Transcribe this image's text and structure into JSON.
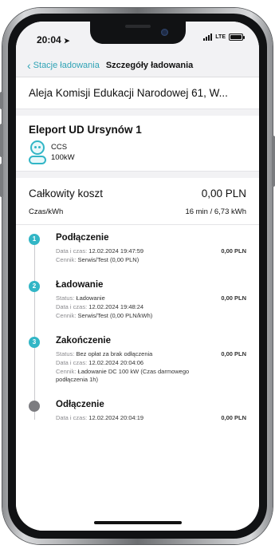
{
  "status_bar": {
    "time": "20:04",
    "network": "LTE",
    "icons": [
      "location-arrow-icon",
      "signal-icon",
      "battery-icon"
    ]
  },
  "nav": {
    "back_label": "Stacje ładowania",
    "title": "Szczegóły ładowania"
  },
  "address": "Aleja Komisji Edukacji Narodowej 61, W...",
  "station": {
    "name": "Eleport UD Ursynów 1",
    "connector_type": "CCS",
    "power": "100kW"
  },
  "cost": {
    "label": "Całkowity koszt",
    "value": "0,00 PLN",
    "time_energy_label": "Czas/kWh",
    "time_energy_value": "16 min / 6,73 kWh"
  },
  "timeline": [
    {
      "step": "1",
      "title": "Podłączenie",
      "details": [
        {
          "key": "Data i czas:",
          "value": "12.02.2024 19:47:59",
          "amount": "0,00 PLN"
        },
        {
          "key": "Cennik:",
          "value": "Serwis/Test (0,00 PLN)"
        }
      ]
    },
    {
      "step": "2",
      "title": "Ładowanie",
      "details": [
        {
          "key": "Status:",
          "value": "Ładowanie",
          "amount": "0,00 PLN"
        },
        {
          "key": "Data i czas:",
          "value": "12.02.2024 19:48:24"
        },
        {
          "key": "Cennik:",
          "value": "Serwis/Test (0,00 PLN/kWh)"
        }
      ]
    },
    {
      "step": "3",
      "title": "Zakończenie",
      "details": [
        {
          "key": "Status:",
          "value": "Bez opłat za brak odłączenia",
          "amount": "0,00 PLN"
        },
        {
          "key": "Data i czas:",
          "value": "12.02.2024 20:04:06"
        },
        {
          "key": "Cennik:",
          "value": "Ładowanie DC 100 kW (Czas darmowego podłączenia 1h)"
        }
      ]
    },
    {
      "step": "",
      "title": "Odłączenie",
      "details": [
        {
          "key": "Data i czas:",
          "value": "12.02.2024 20:04:19",
          "amount": "0,00 PLN"
        }
      ]
    }
  ],
  "colors": {
    "accent": "#32b6c6",
    "link": "#2fa3b5",
    "inactive_dot": "#7c7c80",
    "nav_background": "#f2f2f4"
  }
}
